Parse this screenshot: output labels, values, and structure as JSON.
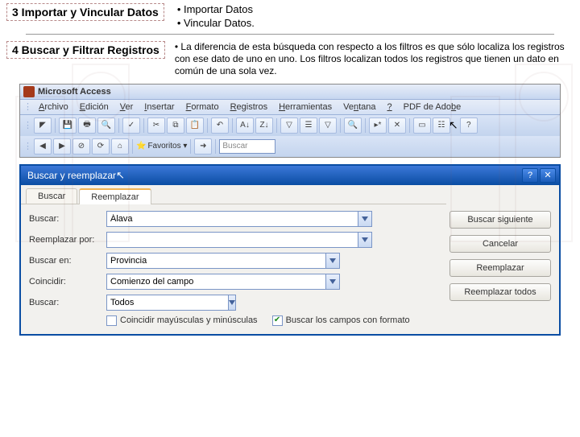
{
  "sections": {
    "s3": {
      "title": "3 Importar y Vincular Datos",
      "bullets": [
        "Importar Datos",
        "Vincular Datos."
      ]
    },
    "s4": {
      "title": "4 Buscar y Filtrar Registros",
      "desc": "La diferencia de esta búsqueda con respecto a los filtros es que sólo localiza los registros con ese dato de uno en uno. Los filtros localizan todos los registros que tienen un dato en común de una sola vez."
    }
  },
  "access": {
    "title": "Microsoft Access",
    "menus": [
      "Archivo",
      "Edición",
      "Ver",
      "Insertar",
      "Formato",
      "Registros",
      "Herramientas",
      "Ventana",
      "?",
      "PDF de Adobe"
    ],
    "search_placeholder": "Buscar",
    "favorites": "Favoritos ▾"
  },
  "dialog": {
    "title": "Buscar y reemplazar",
    "tabs": {
      "find": "Buscar",
      "replace": "Reemplazar"
    },
    "labels": {
      "find": "Buscar:",
      "replace": "Reemplazar por:",
      "lookin": "Buscar en:",
      "match": "Coincidir:",
      "search": "Buscar:"
    },
    "values": {
      "find": "Álava",
      "replace": "",
      "lookin": "Provincia",
      "match": "Comienzo del campo",
      "search": "Todos"
    },
    "checks": {
      "case": "Coincidir mayúsculas y minúsculas",
      "formatted": "Buscar los campos con formato"
    },
    "buttons": {
      "findnext": "Buscar siguiente",
      "cancel": "Cancelar",
      "replace": "Reemplazar",
      "replaceall": "Reemplazar todos"
    }
  }
}
